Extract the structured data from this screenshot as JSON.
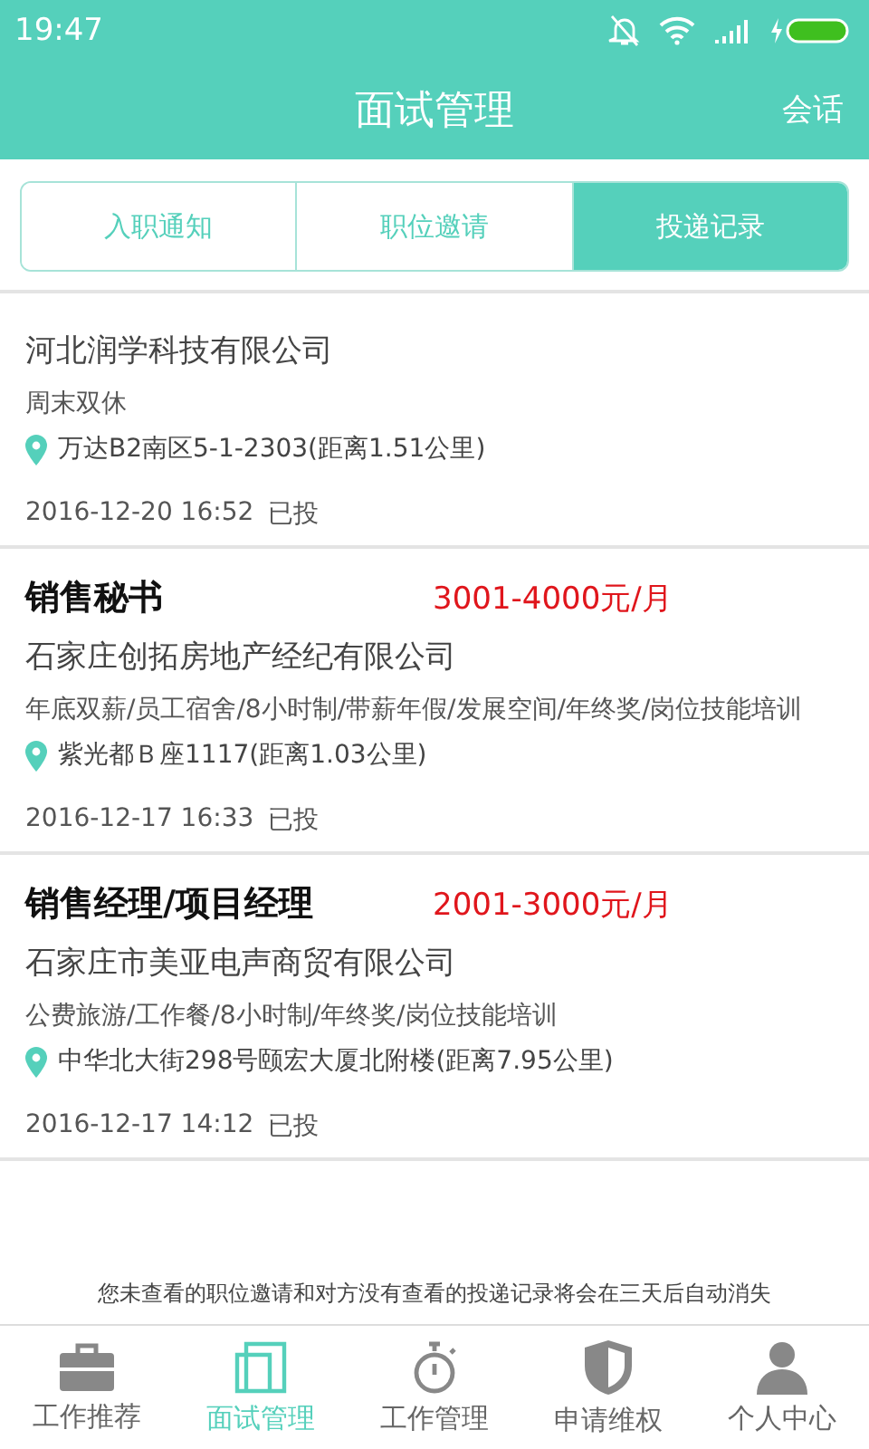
{
  "status_bar": {
    "time": "19:47"
  },
  "header": {
    "title": "面试管理",
    "action": "会话"
  },
  "tabs": [
    {
      "label": "入职通知",
      "selected": false
    },
    {
      "label": "职位邀请",
      "selected": false
    },
    {
      "label": "投递记录",
      "selected": true
    }
  ],
  "records": [
    {
      "company": "河北润学科技有限公司",
      "benefits": "周末双休",
      "address": "万达B2南区5-1-2303(距离1.51公里)",
      "date": "2016-12-20 16:52",
      "status": "已投"
    },
    {
      "title": "销售秘书",
      "salary": "3001-4000元/月",
      "company": "石家庄创拓房地产经纪有限公司",
      "benefits": "年底双薪/员工宿舍/8小时制/带薪年假/发展空间/年终奖/岗位技能培训",
      "address": "紫光都Ｂ座1117(距离1.03公里)",
      "date": "2016-12-17 16:33",
      "status": "已投"
    },
    {
      "title": "销售经理/项目经理",
      "salary": "2001-3000元/月",
      "company": "石家庄市美亚电声商贸有限公司",
      "benefits": "公费旅游/工作餐/8小时制/年终奖/岗位技能培训",
      "address": "中华北大街298号颐宏大厦北附楼(距离7.95公里)",
      "date": "2016-12-17 14:12",
      "status": "已投"
    }
  ],
  "notice": "您未查看的职位邀请和对方没有查看的投递记录将会在三天后自动消失",
  "nav": [
    {
      "kind": "toolbox",
      "label": "工作推荐",
      "selected": false
    },
    {
      "kind": "pages",
      "label": "面试管理",
      "selected": true
    },
    {
      "kind": "stopwatch",
      "label": "工作管理",
      "selected": false
    },
    {
      "kind": "shield",
      "label": "申请维权",
      "selected": false
    },
    {
      "kind": "person",
      "label": "个人中心",
      "selected": false
    }
  ]
}
